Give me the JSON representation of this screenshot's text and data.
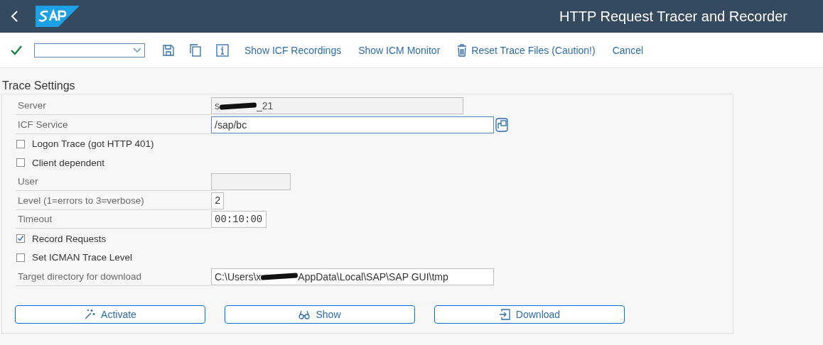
{
  "window": {
    "title": "HTTP Request Tracer and Recorder"
  },
  "toolbar": {
    "links": [
      {
        "label": "Show ICF Recordings",
        "kind": "plain"
      },
      {
        "label": "Show ICM Monitor",
        "kind": "plain"
      },
      {
        "label": "Reset Trace Files (Caution!)",
        "kind": "trash"
      },
      {
        "label": "Cancel",
        "kind": "plain"
      }
    ]
  },
  "section": {
    "title": "Trace Settings"
  },
  "rows": [
    {
      "kind": "field",
      "label": "Server",
      "value": "s",
      "value_end": "_21",
      "editable": false
    },
    {
      "kind": "field",
      "label": "ICF Service",
      "value": "/sap/bc",
      "editable": true,
      "focused": true
    },
    {
      "kind": "check",
      "label": "Logon Trace (got HTTP 401)",
      "checked": false
    },
    {
      "kind": "check",
      "label": "Client dependent",
      "checked": false
    },
    {
      "kind": "field",
      "label": "User",
      "editable": false
    },
    {
      "kind": "field",
      "label": "Level (1=errors to 3=verbose)",
      "value": "2",
      "editable": true
    },
    {
      "kind": "field",
      "label": "Timeout",
      "value": "00:10:00",
      "editable": true
    },
    {
      "kind": "check",
      "label": "Record Requests",
      "checked": true
    },
    {
      "kind": "check",
      "label": "Set ICMAN Trace Level",
      "checked": false
    },
    {
      "kind": "field",
      "label": "Target directory for download",
      "value": "C:\\Users\\x",
      "value_end": "AppData\\Local\\SAP\\SAP GUI\\tmp",
      "editable": true
    }
  ],
  "buttons": [
    {
      "label": "Activate",
      "kind": "wand"
    },
    {
      "label": "Show",
      "kind": "glasses"
    },
    {
      "label": "Download",
      "kind": "download"
    }
  ]
}
